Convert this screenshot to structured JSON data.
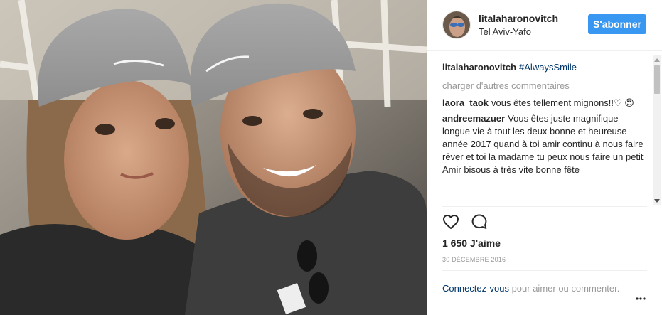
{
  "post": {
    "username": "litalaharonovitch",
    "location": "Tel Aviv-Yafo",
    "follow_label": "S'abonner",
    "caption_user": "litalaharonovitch",
    "caption_hashtag": "#AlwaysSmile",
    "load_more_label": "charger d'autres commentaires",
    "comments": [
      {
        "user": "laora_taok",
        "text": "vous êtes tellement mignons!!♡ 😍"
      },
      {
        "user": "andreemazuer",
        "text": "Vous êtes juste magnifique longue vie à tout les deux bonne et heureuse année 2017 quand à toi amir continu à nous faire rêver et toi la madame tu peux nous faire un petit Amir bisous à très vite bonne fête"
      }
    ],
    "likes_label": "1 650 J'aime",
    "date_label": "30 DÉCEMBRE 2016",
    "login_link_label": "Connectez-vous",
    "login_suffix": " pour aimer ou commenter."
  },
  "icons": {
    "like": "heart-icon",
    "comment": "comment-bubble-icon",
    "more": "more-options-icon"
  },
  "colors": {
    "follow_button": "#3897f0",
    "link": "#003569",
    "muted": "#999999",
    "text": "#262626"
  }
}
